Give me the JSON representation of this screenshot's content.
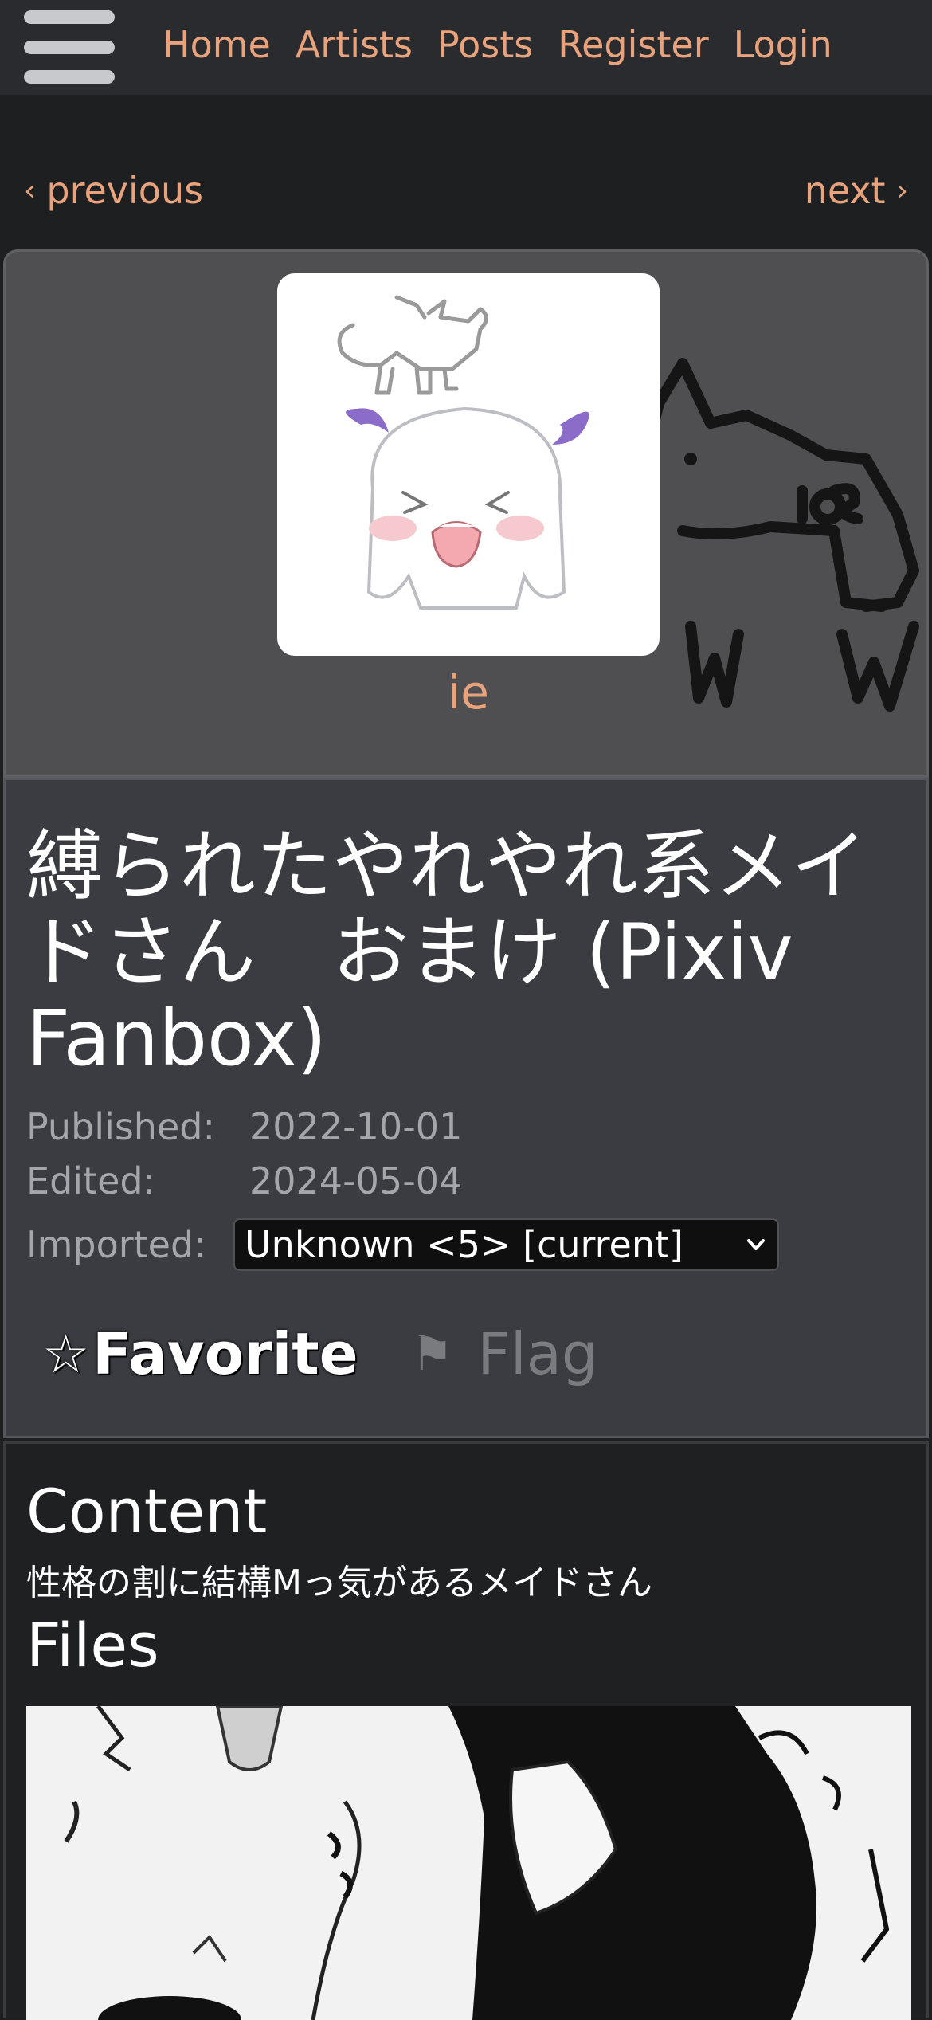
{
  "nav": {
    "links": [
      "Home",
      "Artists",
      "Posts",
      "Register",
      "Login"
    ]
  },
  "pager": {
    "previous": "previous",
    "next": "next"
  },
  "artist": {
    "name": "ie",
    "avatar_icon": "artist-avatar-icon"
  },
  "post": {
    "title": "縛られたやれやれ系メイドさん　おまけ (Pixiv Fanbox)",
    "published_label": "Published:",
    "published": "2022-10-01",
    "edited_label": "Edited:",
    "edited": "2024-05-04",
    "imported_label": "Imported:",
    "revision_selected": "Unknown <5> [current]",
    "favorite_label": "Favorite",
    "flag_label": "Flag"
  },
  "content": {
    "heading": "Content",
    "text": "性格の割に結構Mっ気があるメイドさん",
    "files_heading": "Files"
  },
  "colors": {
    "accent": "#e8a27c",
    "background": "#1e1f21",
    "nav": "#2a2b2e",
    "card": "#3a3c42"
  }
}
